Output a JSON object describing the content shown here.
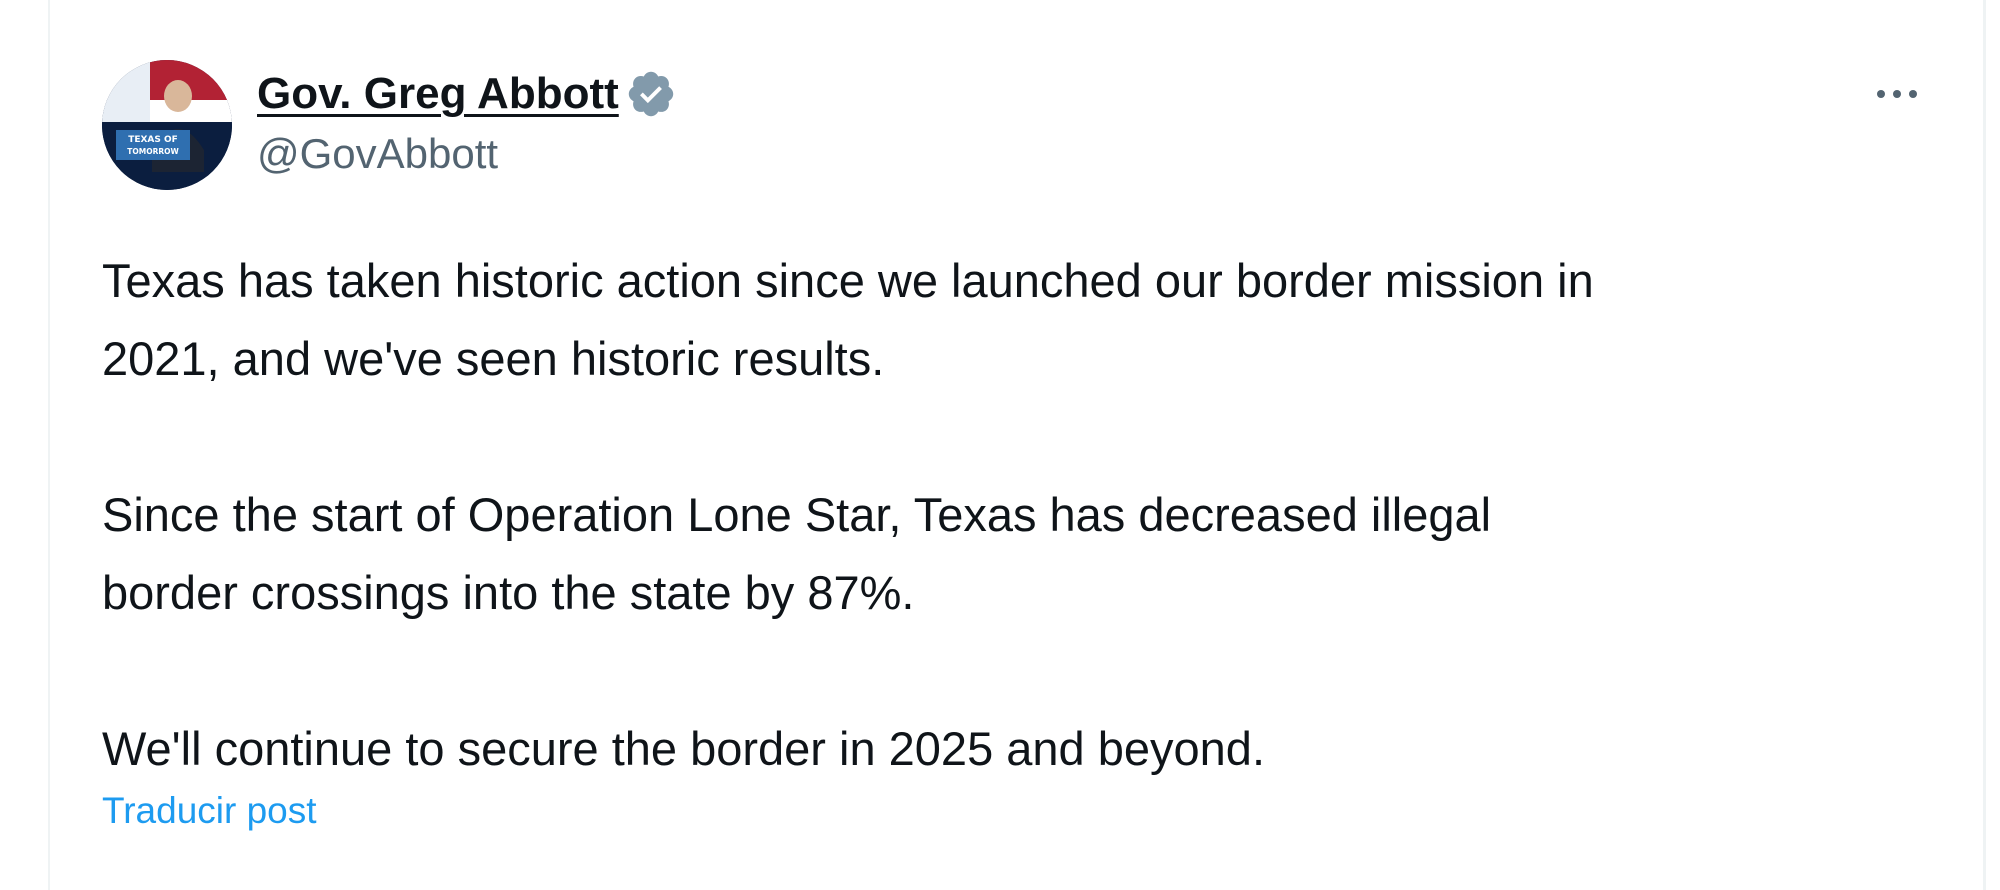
{
  "tweet": {
    "author": {
      "display_name": "Gov. Greg Abbott",
      "handle": "@GovAbbott",
      "verified_icon": "verified-badge-icon",
      "avatar_text": "TEXAS OF TOMORROW"
    },
    "more_icon": "more-options-icon",
    "paragraphs": [
      "Texas has taken historic action since we launched our border mission in\n2021, and we've seen historic results.",
      "Since the start of Operation Lone Star, Texas has decreased illegal\nborder crossings into the state by 87%.",
      "We'll continue to secure the border in 2025 and beyond."
    ],
    "translate_label": "Traducir post"
  },
  "colors": {
    "text_primary": "#0f1419",
    "text_secondary": "#536471",
    "link": "#1d9bf0",
    "verified_badge": "#829aab",
    "border": "#eff3f4"
  }
}
